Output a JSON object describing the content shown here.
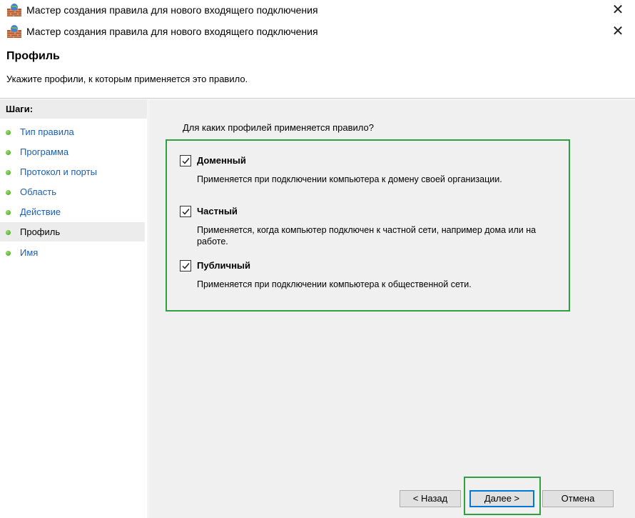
{
  "window": {
    "title": "Мастер создания правила для нового входящего подключения"
  },
  "header": {
    "title": "Профиль",
    "subtitle": "Укажите профили, к которым применяется это правило."
  },
  "sidebar": {
    "heading": "Шаги:",
    "items": [
      {
        "label": "Тип правила"
      },
      {
        "label": "Программа"
      },
      {
        "label": "Протокол и порты"
      },
      {
        "label": "Область"
      },
      {
        "label": "Действие"
      },
      {
        "label": "Профиль",
        "current": true
      },
      {
        "label": "Имя"
      }
    ]
  },
  "main": {
    "question": "Для каких профилей применяется правило?",
    "options": [
      {
        "label": "Доменный",
        "checked": true,
        "description": "Применяется при подключении компьютера к домену своей организации."
      },
      {
        "label": "Частный",
        "checked": true,
        "description": "Применяется, когда компьютер подключен к частной сети, например дома или на работе."
      },
      {
        "label": "Публичный",
        "checked": true,
        "description": "Применяется при подключении компьютера к общественной сети."
      }
    ]
  },
  "buttons": {
    "back": "< Назад",
    "next": "Далее >",
    "cancel": "Отмена"
  },
  "colors": {
    "highlight": "#2ea043",
    "link": "#1a5fb4",
    "focus": "#0078d7"
  }
}
